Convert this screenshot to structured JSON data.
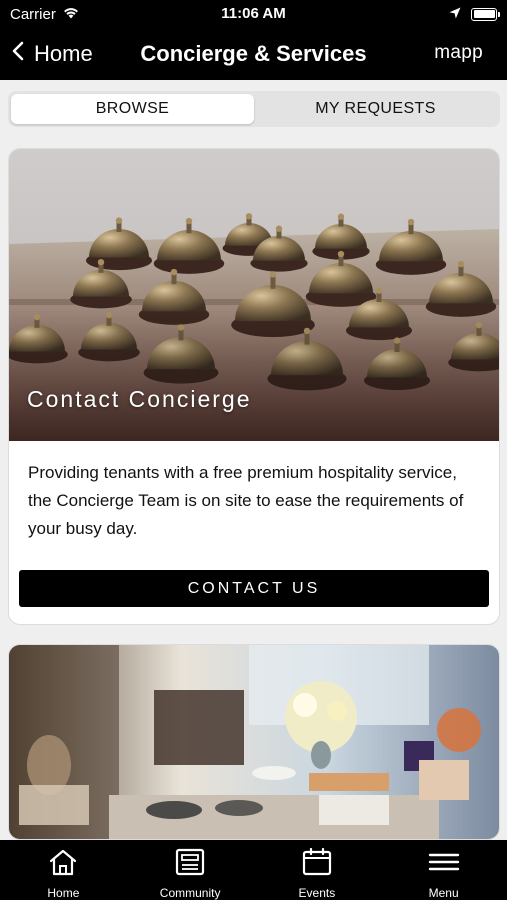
{
  "status_bar": {
    "carrier": "Carrier",
    "time": "11:06 AM",
    "icons": [
      "wifi-icon",
      "location-arrow-icon",
      "battery-icon"
    ]
  },
  "nav": {
    "back_label": "Home",
    "title": "Concierge & Services",
    "logo_text": "mapp"
  },
  "segments": {
    "browse": "BROWSE",
    "my_requests": "MY REQUESTS",
    "selected": "BROWSE"
  },
  "cards": [
    {
      "title": "Contact Concierge",
      "description": "Providing tenants with a free premium hospitality service, the Concierge Team is on site to ease the requirements of your busy day.",
      "button_label": "CONTACT US",
      "image": "service-bells-photo"
    },
    {
      "image": "store-tableware-photo"
    }
  ],
  "tab_bar": [
    {
      "label": "Home",
      "icon": "home-icon"
    },
    {
      "label": "Community",
      "icon": "community-icon"
    },
    {
      "label": "Events",
      "icon": "calendar-icon"
    },
    {
      "label": "Menu",
      "icon": "hamburger-menu-icon"
    }
  ],
  "colors": {
    "bar_background": "#000000",
    "page_background": "#efefef",
    "card_background": "#ffffff",
    "button_background": "#000000"
  }
}
